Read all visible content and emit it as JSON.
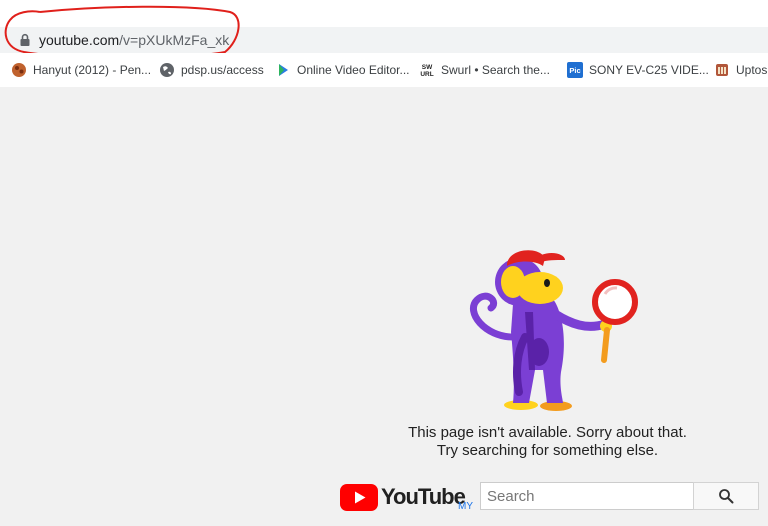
{
  "address_bar": {
    "url_host": "youtube.com",
    "url_path": "/v=pXUkMzFa_xk"
  },
  "bookmarks": [
    {
      "label": "Hanyut (2012) - Pen...",
      "icon": "movie-icon"
    },
    {
      "label": "pdsp.us/access",
      "icon": "globe-icon"
    },
    {
      "label": "Online Video Editor...",
      "icon": "play-icon"
    },
    {
      "label": "Swurl • Search the...",
      "icon": "swurl-icon",
      "icon_text_top": "SW",
      "icon_text_bottom": "URL"
    },
    {
      "label": "SONY EV-C25 VIDE...",
      "icon": "pic-icon",
      "icon_text": "Pic"
    },
    {
      "label": "Uptos",
      "icon": "popcorn-icon"
    }
  ],
  "error": {
    "line1": "This page isn't available. Sorry about that.",
    "line2": "Try searching for something else."
  },
  "logo": {
    "wordmark": "YouTube",
    "region": "MY"
  },
  "search": {
    "placeholder": "Search",
    "button_icon": "search-icon"
  },
  "colors": {
    "annotation": "#e0201b",
    "youtube_red": "#ff0000",
    "monkey_purple": "#7b3fd4",
    "monkey_yellow": "#ffd21e",
    "page_bg": "#f1f1f1"
  }
}
